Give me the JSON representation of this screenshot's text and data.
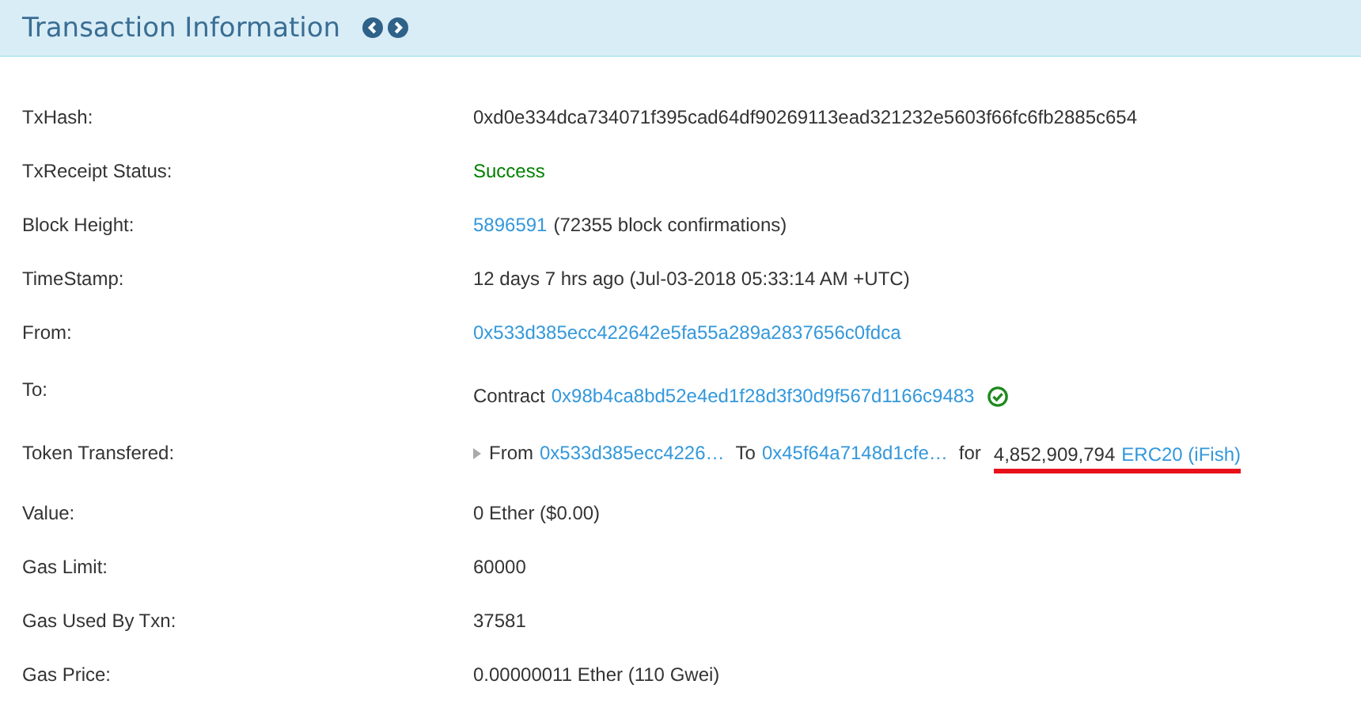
{
  "header": {
    "title": "Transaction Information"
  },
  "rows": [
    {
      "label": "TxHash:",
      "kind": "plain",
      "parts": [
        {
          "kind": "text",
          "text": "0xd0e334dca734071f395cad64df90269113ead321232e5603f66fc6fb2885c654"
        }
      ]
    },
    {
      "label": "TxReceipt Status:",
      "kind": "plain",
      "parts": [
        {
          "kind": "success",
          "text": "Success"
        }
      ]
    },
    {
      "label": "Block Height:",
      "kind": "plain",
      "parts": [
        {
          "kind": "link",
          "text": "5896591"
        },
        {
          "kind": "text",
          "text": "(72355 block confirmations)"
        }
      ]
    },
    {
      "label": "TimeStamp:",
      "kind": "plain",
      "parts": [
        {
          "kind": "text",
          "text": "12 days 7 hrs ago (Jul-03-2018 05:33:14 AM +UTC)"
        }
      ]
    },
    {
      "label": "From:",
      "kind": "plain",
      "parts": [
        {
          "kind": "link",
          "text": "0x533d385ecc422642e5fa55a289a2837656c0fdca"
        }
      ]
    },
    {
      "label": "To:",
      "kind": "plain",
      "verified": true,
      "parts": [
        {
          "kind": "text",
          "text": "Contract"
        },
        {
          "kind": "link",
          "text": "0x98b4ca8bd52e4ed1f28d3f30d9f567d1166c9483"
        }
      ]
    },
    {
      "label": "Token Transfered:",
      "kind": "transfer",
      "expanded": false,
      "from_label": "From",
      "from": "0x533d385ecc4226…",
      "to_label": "To",
      "to": "0x45f64a7148d1cfe…",
      "for_label": "for",
      "amount": "4,852,909,794",
      "token": "ERC20 (iFish)",
      "underlined": true
    },
    {
      "label": "Value:",
      "kind": "plain",
      "parts": [
        {
          "kind": "text",
          "text": "0 Ether ($0.00)"
        }
      ]
    },
    {
      "label": "Gas Limit:",
      "kind": "plain",
      "parts": [
        {
          "kind": "text",
          "text": "60000"
        }
      ]
    },
    {
      "label": "Gas Used By Txn:",
      "kind": "plain",
      "parts": [
        {
          "kind": "text",
          "text": "37581"
        }
      ]
    },
    {
      "label": "Gas Price:",
      "kind": "plain",
      "parts": [
        {
          "kind": "text",
          "text": "0.00000011 Ether (110 Gwei)"
        }
      ]
    }
  ]
}
